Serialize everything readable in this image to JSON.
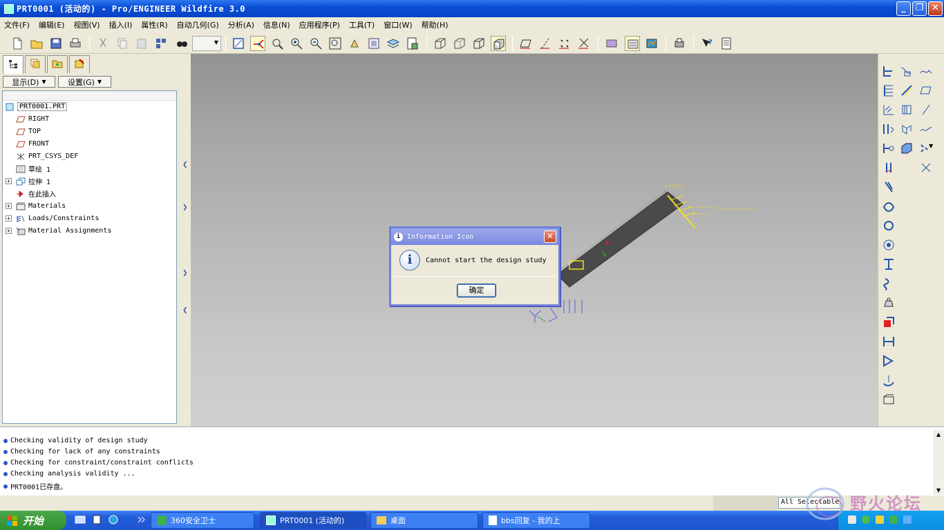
{
  "window": {
    "title": "PRT0001 (活动的) - Pro/ENGINEER Wildfire 3.0",
    "controls": [
      "minimize-icon",
      "maximize-icon",
      "close-icon"
    ]
  },
  "menubar": {
    "items": [
      "文件(F)",
      "编辑(E)",
      "视图(V)",
      "插入(I)",
      "属性(R)",
      "自动几何(G)",
      "分析(A)",
      "信息(N)",
      "应用程序(P)",
      "工具(T)",
      "窗口(W)",
      "帮助(H)"
    ]
  },
  "left_panel": {
    "display_button": "显示(D)",
    "settings_button": "设置(G)",
    "tabs": [
      "model-tree-icon",
      "layer-icon",
      "folder-icon",
      "favorites-icon"
    ],
    "tree": [
      {
        "label": "PRT0001.PRT",
        "icon": "part-icon",
        "expandable": false,
        "root": true
      },
      {
        "label": "RIGHT",
        "icon": "datum-plane-icon",
        "expandable": false
      },
      {
        "label": "TOP",
        "icon": "datum-plane-icon",
        "expandable": false
      },
      {
        "label": "FRONT",
        "icon": "datum-plane-icon",
        "expandable": false
      },
      {
        "label": "PRT_CSYS_DEF",
        "icon": "csys-icon",
        "expandable": false
      },
      {
        "label": "草绘 1",
        "icon": "sketch-icon",
        "expandable": false
      },
      {
        "label": "拉伸 1",
        "icon": "extrude-icon",
        "expandable": true
      },
      {
        "label": "在此插入",
        "icon": "insert-arrow-icon",
        "expandable": false
      },
      {
        "label": "Materials",
        "icon": "materials-icon",
        "expandable": true
      },
      {
        "label": "Loads/Constraints",
        "icon": "loads-icon",
        "expandable": true
      },
      {
        "label": "Material Assignments",
        "icon": "material-assign-icon",
        "expandable": true
      }
    ]
  },
  "canvas": {
    "annotation_lbl": "LE0001",
    "colors": {
      "beam": "#4a4a4a",
      "load": "#f0e020",
      "constraint": "#5e5ed8"
    }
  },
  "dialog": {
    "title": "Information Icon",
    "message": "Cannot start the design study",
    "ok_button": "确定",
    "icon": "info-icon"
  },
  "messages": [
    "Checking validity of design study",
    "Checking for lack of any constraints",
    "Checking for constraint/constraint conflicts",
    "Checking analysis validity ...",
    "PRT0001已存盘。"
  ],
  "status": {
    "filter": "All Selectable"
  },
  "taskbar": {
    "start": "开始",
    "tasks": [
      {
        "label": "360安全卫士",
        "active": false
      },
      {
        "label": "PRT0001 (活动的)",
        "active": true
      },
      {
        "label": "桌面",
        "active": false
      },
      {
        "label": "bbs回复 - 我的上",
        "active": false
      }
    ],
    "watermark": "野火论坛"
  }
}
